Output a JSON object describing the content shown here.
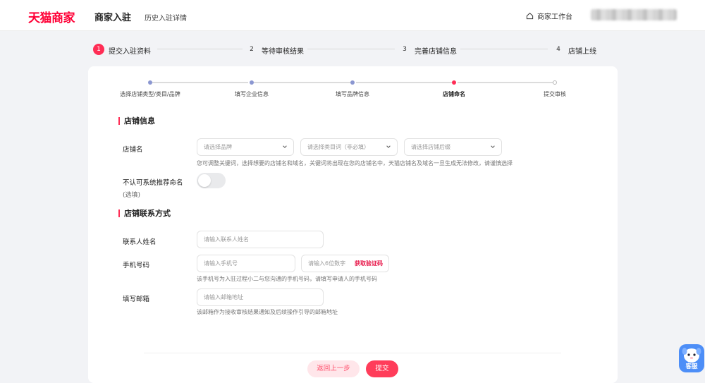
{
  "header": {
    "logo_text": "天猫商家",
    "title": "商家入驻",
    "history_link": "历史入驻详情",
    "workbench_label": "商家工作台",
    "workbench_icon": "home-icon"
  },
  "main_steps": [
    {
      "number": "1",
      "label": "提交入驻资料",
      "state": "active"
    },
    {
      "number": "2",
      "label": "等待审核结果",
      "state": "idle"
    },
    {
      "number": "3",
      "label": "完善店铺信息",
      "state": "idle"
    },
    {
      "number": "4",
      "label": "店铺上线",
      "state": "idle"
    }
  ],
  "sub_steps": [
    {
      "label": "选择店铺类型/类目/品牌",
      "state": "done"
    },
    {
      "label": "填写企业信息",
      "state": "done"
    },
    {
      "label": "填写品牌信息",
      "state": "done"
    },
    {
      "label": "店铺命名",
      "state": "current"
    },
    {
      "label": "提交审核",
      "state": "todo"
    }
  ],
  "store_info": {
    "section_title": "店铺信息",
    "name_label": "店铺名",
    "brand_placeholder": "请选择品牌",
    "category_placeholder": "请选择类目词（非必填）",
    "suffix_placeholder": "请选择店铺后缀",
    "name_help": "您可调整关键词，选择想要的店铺名和域名，关键词将出现在您的店铺名中，天猫店铺名及域名一旦生成无法修改，请谨慎选择",
    "reject_label": "不认可系统推荐命名",
    "reject_optional": "(选填)",
    "reject_toggle_on": false
  },
  "contact": {
    "section_title": "店铺联系方式",
    "name_label": "联系人姓名",
    "name_placeholder": "请输入联系人姓名",
    "phone_label": "手机号码",
    "phone_placeholder": "请输入手机号",
    "code_placeholder": "请输入6位数字",
    "get_code": "获取验证码",
    "phone_help": "该手机号为入驻过程小二与您沟通的手机号码，请填写申请人的手机号码",
    "email_label": "填写邮箱",
    "email_placeholder": "请输入邮箱地址",
    "email_help": "该邮箱作为接收审核结果通知及后续操作引导的邮箱地址"
  },
  "footer": {
    "back_button": "返回上一步",
    "submit_button": "提交"
  },
  "customer_service": {
    "label": "客服",
    "icon": "customer-service-mascot-icon"
  },
  "colors": {
    "accent": "#ff2d55",
    "logo": "#ff0036",
    "step_done": "#8b97d1",
    "cs_widget": "#4d8ef7"
  }
}
